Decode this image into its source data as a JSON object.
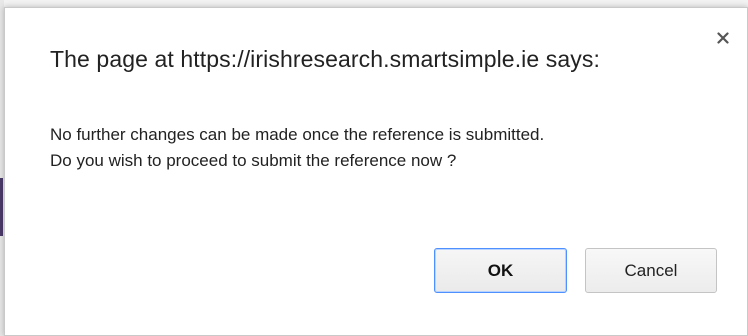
{
  "dialog": {
    "title": "The page at https://irishresearch.smartsimple.ie says:",
    "message_lines": [
      "No further changes can be made once the reference is submitted.",
      "Do you wish to proceed to submit the reference now ?"
    ],
    "close_icon": "close-icon",
    "ok_label": "OK",
    "cancel_label": "Cancel"
  },
  "colors": {
    "focus_ring": "#4d90fe",
    "text": "#222222",
    "background": "#ffffff"
  }
}
